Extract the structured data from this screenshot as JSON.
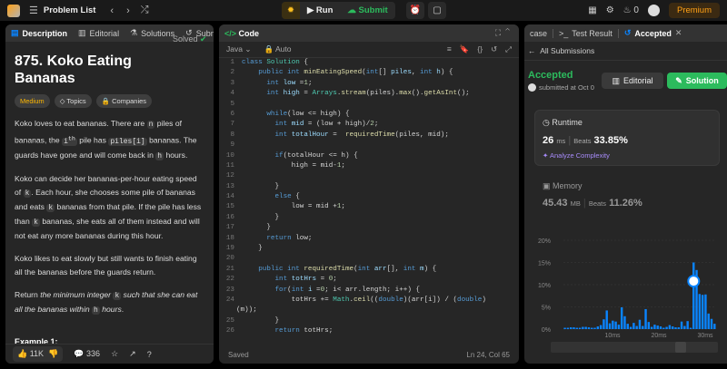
{
  "topbar": {
    "problem_list": "Problem List",
    "run": "Run",
    "submit": "Submit",
    "streak": "0",
    "premium": "Premium"
  },
  "left": {
    "tabs": [
      "Description",
      "Editorial",
      "Solutions",
      "Subm"
    ],
    "title": "875. Koko Eating Bananas",
    "solved": "Solved",
    "chips": [
      "Medium",
      "Topics",
      "Companies"
    ],
    "example": "Example 1:",
    "likes": "11K",
    "comments": "336"
  },
  "code": {
    "title": "Code",
    "lang": "Java",
    "mode": "Auto",
    "status": "Saved",
    "position": "Ln 24, Col 65"
  },
  "right": {
    "tabs": [
      "case",
      "Test Result",
      "Accepted"
    ],
    "back": "All Submissions",
    "status": "Accepted",
    "submitted": "submitted at Oct 0",
    "editorial": "Editorial",
    "solution": "Solution",
    "runtime_label": "Runtime",
    "runtime_value": "26",
    "runtime_unit": "ms",
    "beats_label": "Beats",
    "runtime_beats": "33.85%",
    "analyze": "Analyze Complexity",
    "memory_label": "Memory",
    "memory_value": "45.43",
    "memory_unit": "MB",
    "memory_beats": "11.26%"
  },
  "chart_data": {
    "type": "bar",
    "title": "",
    "xlabel": "",
    "ylabel": "",
    "ylim": [
      0,
      20
    ],
    "yticks": [
      "20%",
      "15%",
      "10%",
      "5%",
      "0%"
    ],
    "xticks": [
      "10ms",
      "20ms",
      "30ms"
    ],
    "values": [
      0.3,
      0.3,
      0.4,
      0.4,
      0.3,
      0.3,
      0.5,
      0.5,
      0.4,
      0.3,
      0.3,
      0.6,
      0.9,
      2.2,
      4.2,
      1.3,
      1.9,
      1.7,
      1,
      4.9,
      2.9,
      1.2,
      0.5,
      1.4,
      0.7,
      2.1,
      0.7,
      4.5,
      1.6,
      0.5,
      1,
      0.8,
      0.6,
      0.3,
      0.5,
      0.9,
      0.6,
      0.4,
      0.4,
      1.7,
      0.7,
      1.8,
      0.3,
      15,
      13.3,
      7.9,
      7.7,
      7.8,
      3.5,
      2.3,
      1.2
    ],
    "highlight_index": 43,
    "color": "#0a84ff"
  }
}
